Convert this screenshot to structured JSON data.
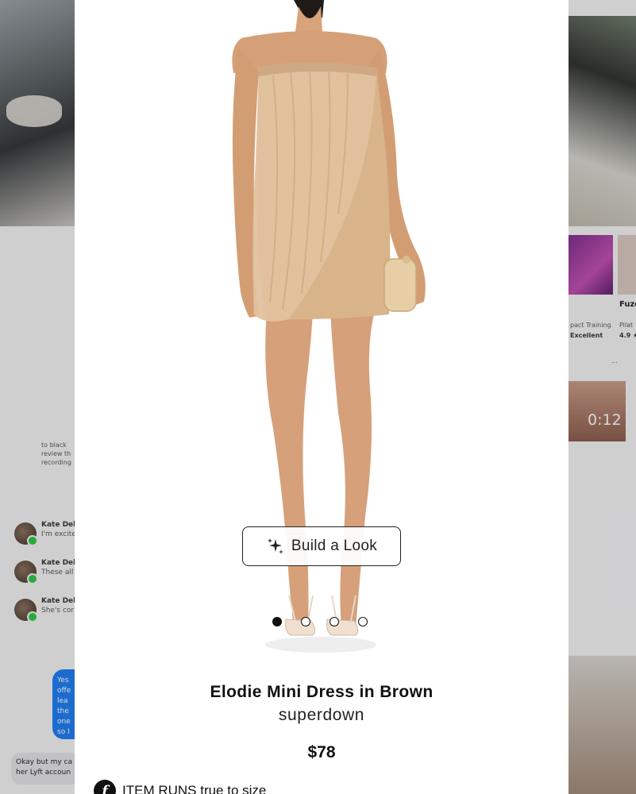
{
  "background": {
    "chats": [
      {
        "name": "Kate Dela",
        "text": "I'm excite"
      },
      {
        "name": "Kate Dela",
        "text": "These all"
      },
      {
        "name": "Kate Dela",
        "text": "She's cor"
      }
    ],
    "chat_top_lines": [
      "to black",
      "review th",
      "recording"
    ],
    "blue_bubble_lines": [
      "Yes",
      "offe",
      "lea",
      "the",
      "one",
      "so I"
    ],
    "gray_bubble_lines": [
      "Okay but my ca",
      "her Lyft accoun"
    ],
    "right_texts": {
      "fuze": "Fuze",
      "impact_training": "pact Training",
      "pilates": "Pilat",
      "excellent": "Excellent",
      "rating": "4.9 ★",
      "video_time": "0:12",
      "ellipsis": "..."
    }
  },
  "modal": {
    "build_look_label": "Build a Look",
    "carousel": {
      "count": 4,
      "active_index": 0
    },
    "title": "Elodie Mini Dress in Brown",
    "brand": "superdown",
    "price": "$78",
    "fit_text": "ITEM RUNS  true to size",
    "icons": {
      "build_look": "sparkle-icon",
      "fit": "fit-icon"
    }
  },
  "colors": {
    "dress": "#d9b48b",
    "skin": "#d8a27a",
    "clutch": "#e6cfa6",
    "text": "#111111"
  }
}
